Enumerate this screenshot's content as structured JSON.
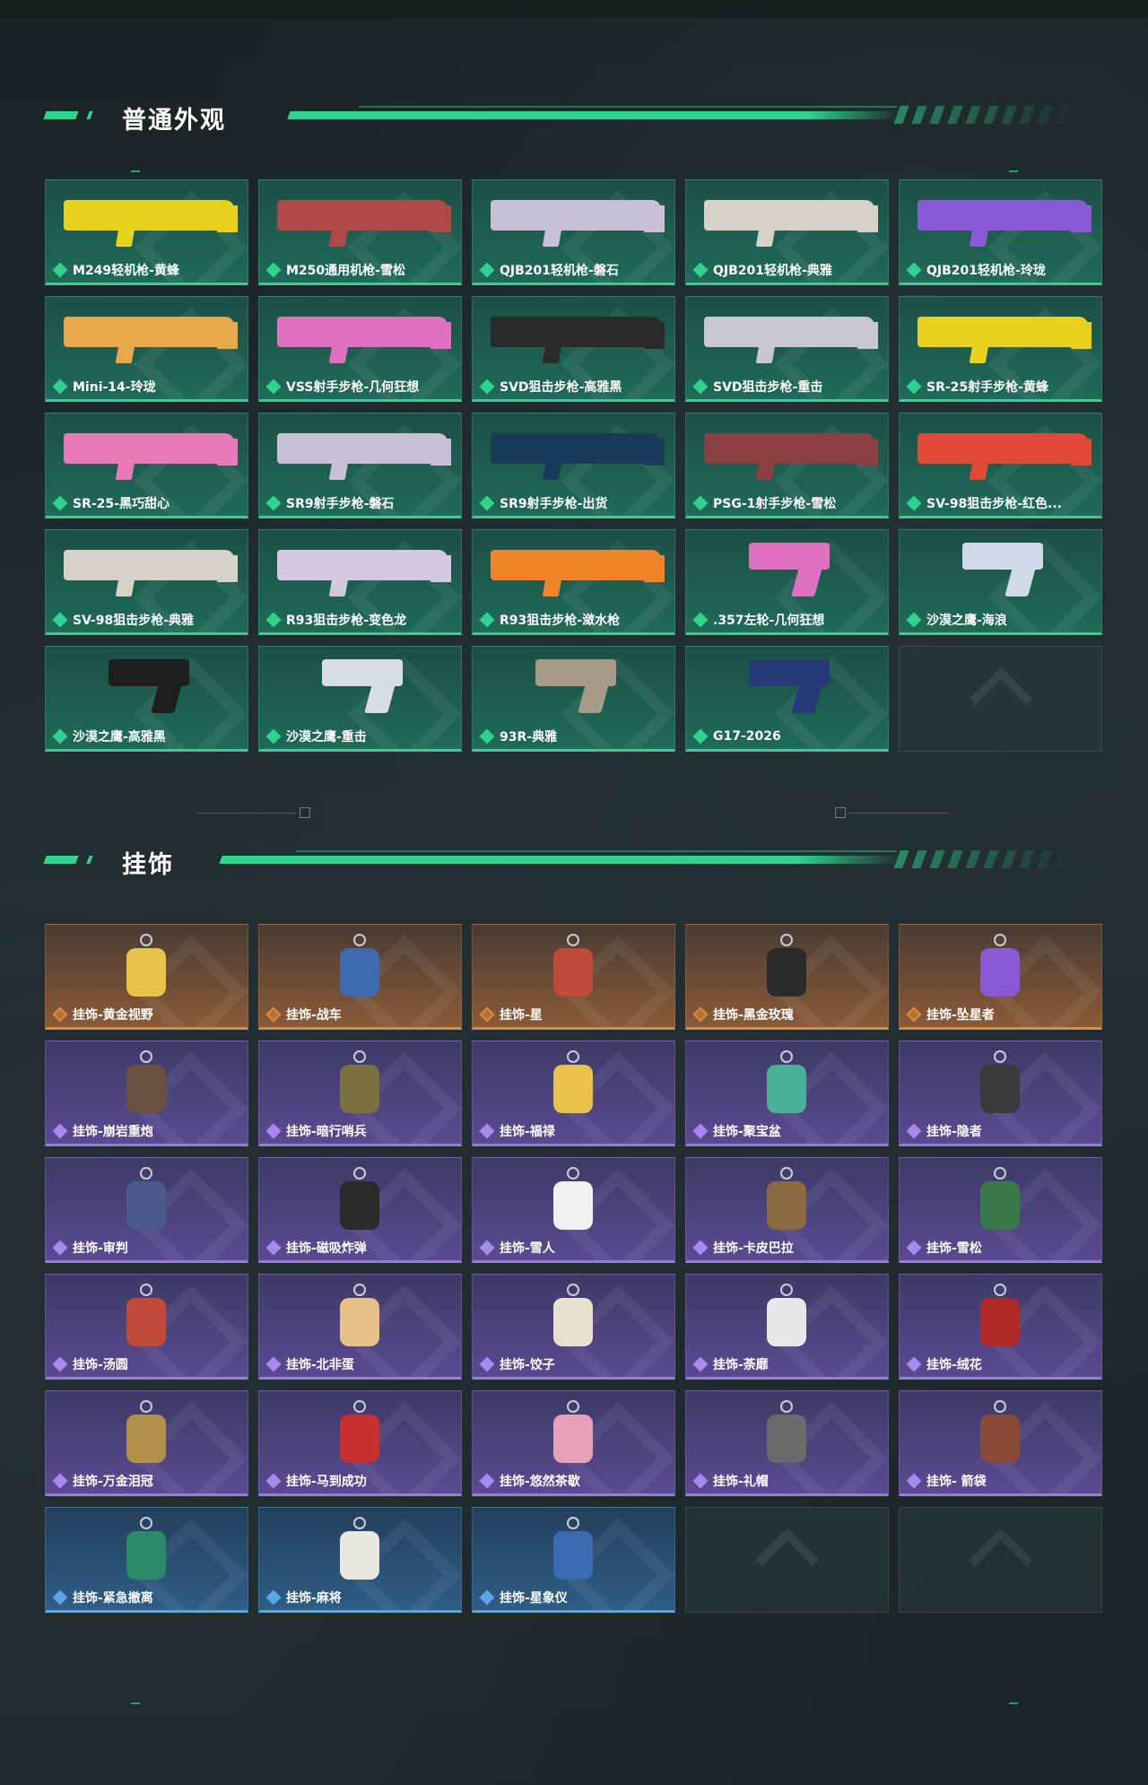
{
  "sections": {
    "skins": {
      "title": "普通外观",
      "items": [
        {
          "label": "M249轻机枪-黄蜂",
          "color": "#e8d21e"
        },
        {
          "label": "M250通用机枪-雪松",
          "color": "#b04848"
        },
        {
          "label": "QJB201轻机枪-磐石",
          "color": "#c7c0d6"
        },
        {
          "label": "QJB201轻机枪-典雅",
          "color": "#d6d2c8"
        },
        {
          "label": "QJB201轻机枪-玲珑",
          "color": "#8a5ad6"
        },
        {
          "label": "Mini-14-玲珑",
          "color": "#e6a84a"
        },
        {
          "label": "VSS射手步枪-几何狂想",
          "color": "#e070c0"
        },
        {
          "label": "SVD狙击步枪-高雅黑",
          "color": "#2a2a2a"
        },
        {
          "label": "SVD狙击步枪-重击",
          "color": "#c8c8d4"
        },
        {
          "label": "SR-25射手步枪-黄蜂",
          "color": "#e8d21e"
        },
        {
          "label": "SR-25-黑巧甜心",
          "color": "#e87ab8"
        },
        {
          "label": "SR9射手步枪-磐石",
          "color": "#c7c0d6"
        },
        {
          "label": "SR9射手步枪-出货",
          "color": "#1a3a5a"
        },
        {
          "label": "PSG-1射手步枪-雪松",
          "color": "#8a4040"
        },
        {
          "label": "SV-98狙击步枪-红色...",
          "color": "#e0483a"
        },
        {
          "label": "SV-98狙击步枪-典雅",
          "color": "#d6d2c8"
        },
        {
          "label": "R93狙击步枪-变色龙",
          "color": "#d2c8e0"
        },
        {
          "label": "R93狙击步枪-潋水枪",
          "color": "#f0842a"
        },
        {
          "label": ".357左轮-几何狂想",
          "color": "#e070c0"
        },
        {
          "label": "沙漠之鹰-海浪",
          "color": "#d0dae8"
        },
        {
          "label": "沙漠之鹰-高雅黑",
          "color": "#1e1e1e"
        },
        {
          "label": "沙漠之鹰-重击",
          "color": "#d8dce4"
        },
        {
          "label": "93R-典雅",
          "color": "#a89a88"
        },
        {
          "label": "G17-2026",
          "color": "#263a78"
        }
      ]
    },
    "charms": {
      "title": "挂饰",
      "items": [
        {
          "label": "挂饰-黄金视野",
          "rarity": "orange",
          "color": "#e8c24a"
        },
        {
          "label": "挂饰-战车",
          "rarity": "orange",
          "color": "#3e6ab0"
        },
        {
          "label": "挂饰-星",
          "rarity": "orange",
          "color": "#c04a3a"
        },
        {
          "label": "挂饰-黑金玫瑰",
          "rarity": "orange",
          "color": "#2a2a2a"
        },
        {
          "label": "挂饰-坠星者",
          "rarity": "orange",
          "color": "#8a5ad6"
        },
        {
          "label": "挂饰-崩岩重炮",
          "rarity": "purple",
          "color": "#6a5040"
        },
        {
          "label": "挂饰-暗行哨兵",
          "rarity": "purple",
          "color": "#7a7040"
        },
        {
          "label": "挂饰-福禄",
          "rarity": "purple",
          "color": "#e8c24a"
        },
        {
          "label": "挂饰-聚宝盆",
          "rarity": "purple",
          "color": "#4ab098"
        },
        {
          "label": "挂饰-隐者",
          "rarity": "purple",
          "color": "#3a3a3a"
        },
        {
          "label": "挂饰-审判",
          "rarity": "purple",
          "color": "#4a5a8a"
        },
        {
          "label": "挂饰-磁吸炸弹",
          "rarity": "purple",
          "color": "#2a2a2a"
        },
        {
          "label": "挂饰-雪人",
          "rarity": "purple",
          "color": "#f0f0f0"
        },
        {
          "label": "挂饰-卡皮巴拉",
          "rarity": "purple",
          "color": "#8a6a40"
        },
        {
          "label": "挂饰-雪松",
          "rarity": "purple",
          "color": "#3a7a4a"
        },
        {
          "label": "挂饰-汤圆",
          "rarity": "purple",
          "color": "#c04a3a"
        },
        {
          "label": "挂饰-北非蛋",
          "rarity": "purple",
          "color": "#e8c08a"
        },
        {
          "label": "挂饰-饺子",
          "rarity": "purple",
          "color": "#e8e0d0"
        },
        {
          "label": "挂饰-荼靡",
          "rarity": "purple",
          "color": "#e8e8e8"
        },
        {
          "label": "挂饰-绒花",
          "rarity": "purple",
          "color": "#b02a2a"
        },
        {
          "label": "挂饰-万金泪冠",
          "rarity": "purple",
          "color": "#b0904a"
        },
        {
          "label": "挂饰-马到成功",
          "rarity": "purple",
          "color": "#c83030"
        },
        {
          "label": "挂饰-悠然茶歇",
          "rarity": "purple",
          "color": "#e8a0b8"
        },
        {
          "label": "挂饰-礼帽",
          "rarity": "purple",
          "color": "#6a6a6a"
        },
        {
          "label": "挂饰- 箭袋",
          "rarity": "purple",
          "color": "#8a4a3a"
        },
        {
          "label": "挂饰-紧急撤离",
          "rarity": "blue",
          "color": "#2a8a6a"
        },
        {
          "label": "挂饰-麻将",
          "rarity": "blue",
          "color": "#e8e8e0"
        },
        {
          "label": "挂饰-星象仪",
          "rarity": "blue",
          "color": "#3a6ab0"
        }
      ]
    }
  }
}
